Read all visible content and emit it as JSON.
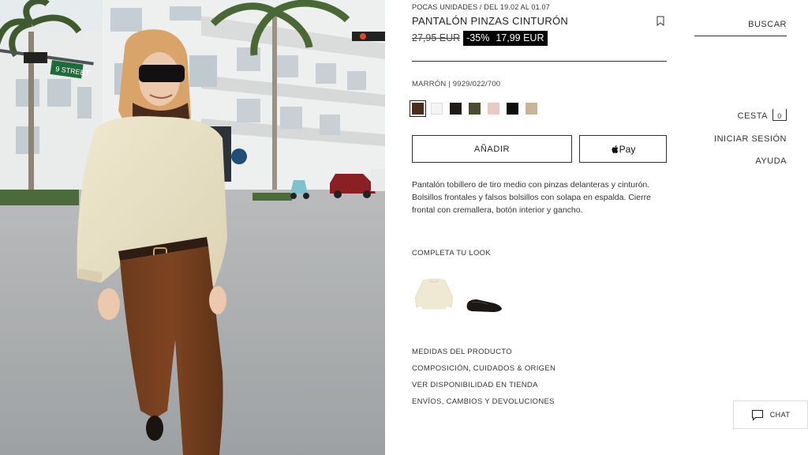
{
  "product": {
    "subtitle": "POCAS UNIDADES / DEL 19.02 AL 01.07",
    "title": "PANTALÓN PINZAS CINTURÓN",
    "old_price": "27,95 EUR",
    "discount": "-35%",
    "price": "17,99 EUR",
    "color_ref": "MARRÓN | 9929/022/700",
    "swatches": [
      "#4a2e1d",
      "#f4f4f2",
      "#1e1a18",
      "#4b4a32",
      "#e9c9c5",
      "#0c0c0c",
      "#c8b49a"
    ],
    "selected_swatch": 0,
    "add_button": "AÑADIR",
    "pay_button": "Pay",
    "description": "Pantalón tobillero de tiro medio con pinzas delanteras y cinturón. Bolsillos frontales y falsos bolsillos con solapa en espalda. Cierre frontal con cremallera, botón interior y gancho."
  },
  "look": {
    "title": "COMPLETA TU LOOK",
    "items": [
      "sweater-thumbnail",
      "shoe-thumbnail"
    ]
  },
  "links": [
    "MEDIDAS DEL PRODUCTO",
    "COMPOSICIÓN, CUIDADOS & ORIGEN",
    "VER DISPONIBILIDAD EN TIENDA",
    "ENVÍOS, CAMBIOS Y DEVOLUCIONES"
  ],
  "nav": {
    "search": "BUSCAR",
    "cart": "CESTA",
    "cart_count": "0",
    "login": "INICIAR SESIÓN",
    "help": "AYUDA"
  },
  "photo": {
    "street_sign": "9 STREET"
  },
  "chat": {
    "label": "CHAT"
  }
}
